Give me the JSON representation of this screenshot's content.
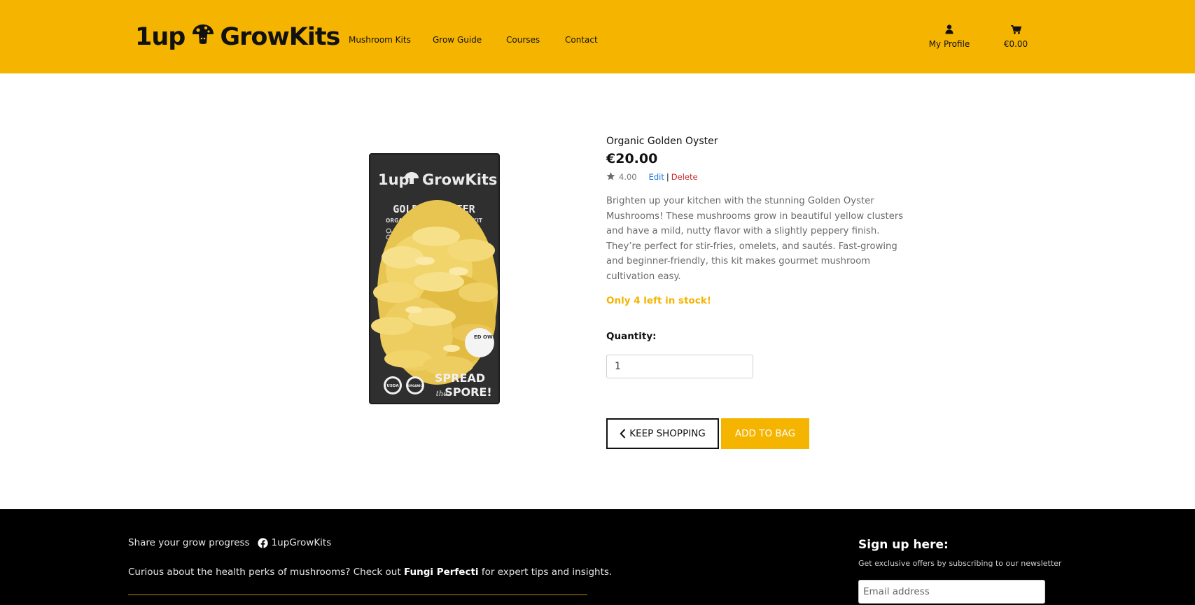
{
  "header": {
    "brand_prefix": "1up",
    "brand_suffix": "GrowKits",
    "nav": [
      "Mushroom Kits",
      "Grow Guide",
      "Courses",
      "Contact"
    ],
    "profile_label": "My Profile",
    "cart_total": "€0.00"
  },
  "product": {
    "title": "Organic Golden Oyster",
    "price": "€20.00",
    "rating": "4.00",
    "edit_label": "Edit",
    "separator": "|",
    "delete_label": "Delete",
    "description": "Brighten up your kitchen with the stunning Golden Oyster Mushrooms! These mushrooms grow in beautiful yellow clusters and have a mild, nutty flavor with a slightly peppery finish. They’re perfect for stir-fries, omelets, and sautés. Fast-growing and beginner-friendly, this kit makes gourmet mushroom cultivation easy.",
    "stock_message": "Only 4 left in stock!",
    "quantity_label": "Quantity:",
    "quantity_value": "1",
    "keep_shopping_label": "KEEP SHOPPING",
    "add_to_bag_label": "ADD TO BAG",
    "image": {
      "box_brand_prefix": "1up",
      "box_brand_suffix": "GrowKits",
      "box_title": "GOLDEN OYSTER",
      "box_subtitle": "ORGANIC MUSHROOM GROW KIT",
      "box_slogan_1": "SPREAD",
      "box_slogan_2": "the",
      "box_slogan_3": "SPORE!",
      "badge_usda": "USDA",
      "badge_organic": "ORGANIC",
      "sticker": "ED\nOWN"
    }
  },
  "footer": {
    "share_text": "Share your grow progress",
    "social_handle": "1upGrowKits",
    "curious_before": "Curious about the health perks of mushrooms? Check out ",
    "curious_link": "Fungi Perfecti",
    "curious_after": " for expert tips and insights.",
    "signup_title": "Sign up here:",
    "signup_subtitle": "Get exclusive offers by subscribing to our newsletter",
    "email_placeholder": "Email address"
  },
  "colors": {
    "brand_yellow": "#f5b400",
    "footer_bg": "#000000",
    "edit_link": "#1a73d9",
    "delete_link": "#c62828"
  },
  "icons": [
    "mushroom-logo-icon",
    "user-icon",
    "cart-icon",
    "star-icon",
    "chevron-left-icon",
    "facebook-icon"
  ]
}
